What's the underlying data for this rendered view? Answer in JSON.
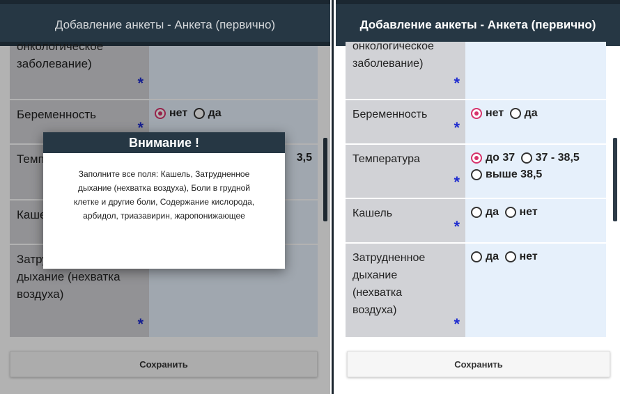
{
  "title": "Добавление анкеты - Анкета (первично)",
  "save_label": "Сохранить",
  "star": "*",
  "left": {
    "rows": {
      "disease_label": "заболевание)",
      "disease_label_cut": "онкологическое",
      "pregnancy_label": "Беременность",
      "pregnancy_no": "нет",
      "pregnancy_yes": "да",
      "temp_label": "Температура",
      "temp_visible_tail": "3,5",
      "cough_label": "Кашель",
      "breath_label": "Затрудненное дыхание (нехватка воздуха)"
    },
    "dialog": {
      "title": "Внимание !",
      "message": "Заполните все поля: Кашель, Затрудненное дыхание (нехватка воздуха), Боли в грудной клетке и другие боли, Содержание кислорода, арбидол, триазавирин, жаропонижающее"
    }
  },
  "right": {
    "rows": {
      "disease_label": "заболевание)",
      "disease_label_cut": "онкологическое",
      "pregnancy_label": "Беременность",
      "pregnancy_no": "нет",
      "pregnancy_yes": "да",
      "temp_label": "Температура",
      "temp_opt1": "до 37",
      "temp_opt2": "37 - 38,5",
      "temp_opt3": "выше 38,5",
      "cough_label": "Кашель",
      "cough_yes": "да",
      "cough_no": "нет",
      "breath_label": "Затрудненное дыхание (нехватка воздуха)",
      "breath_yes": "да",
      "breath_no": "нет"
    }
  }
}
